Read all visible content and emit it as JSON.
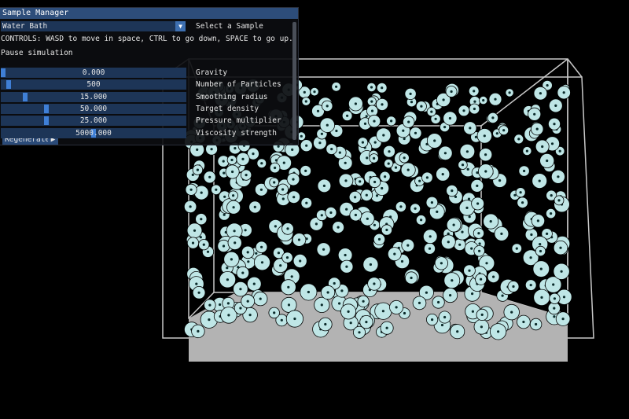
{
  "window": {
    "title": "Sample Manager"
  },
  "sample_select": {
    "value": "Water Bath",
    "label": "Select a Sample",
    "arrow_icon": "triangle-down-icon"
  },
  "controls_text": "CONTROLS: WASD to move in space, CTRL to go down, SPACE to go up.",
  "checkbox_label": "Pause simulation",
  "sliders": [
    {
      "name": "gravity",
      "value": "0.000",
      "label": "Gravity",
      "level": 0.0
    },
    {
      "name": "particles",
      "value": "500",
      "label": "Number of Particles",
      "level": 0.03
    },
    {
      "name": "smoothing",
      "value": "15.000",
      "label": "Smoothing radius",
      "level": 0.12
    },
    {
      "name": "density",
      "value": "50.000",
      "label": "Target density",
      "level": 0.24
    },
    {
      "name": "pressure",
      "value": "25.000",
      "label": "Pressure multiplier",
      "level": 0.24
    },
    {
      "name": "viscosity",
      "value": "5000.000",
      "label": "Viscosity strength",
      "level": 0.5
    }
  ],
  "buttons": {
    "regenerate": "Regenerate",
    "play_icon": "play-icon"
  },
  "colors": {
    "particle": "#bfe6e6",
    "floor": "#b3b3b3",
    "box": "#c8c8c8",
    "title_bar": "#2d4d7a",
    "slider_bg": "#1d3557",
    "slider_grab": "#3f7fd6"
  }
}
